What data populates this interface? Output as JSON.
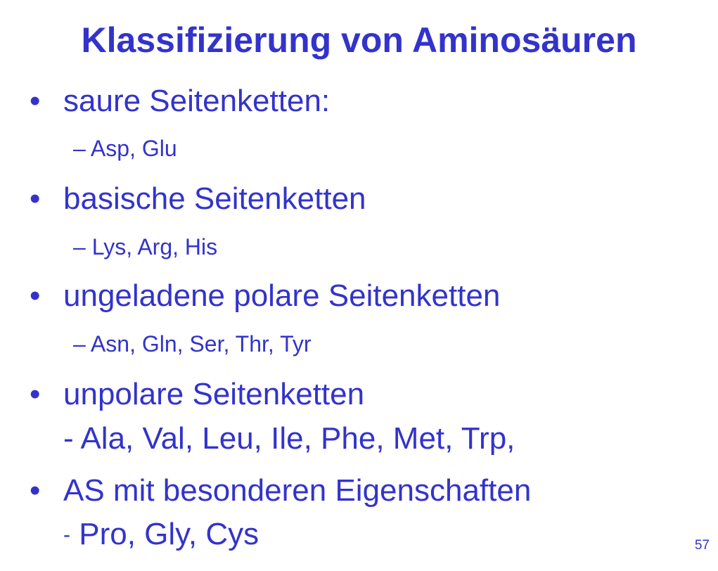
{
  "slide": {
    "title": "Klassifizierung von Aminosäuren",
    "bullet_glyph": "•",
    "items": [
      {
        "text": "saure Seitenketten:",
        "sub": "– Asp, Glu"
      },
      {
        "text": "basische Seitenketten",
        "sub": "– Lys, Arg, His"
      },
      {
        "text": "ungeladene polare Seitenketten",
        "sub": "– Asn, Gln, Ser, Thr, Tyr"
      },
      {
        "text": "unpolare Seitenketten",
        "cont": "- Ala, Val, Leu, Ile, Phe, Met, Trp,"
      },
      {
        "text": "AS mit besonderen Eigenschaften",
        "cont_dash": "-",
        "cont": "Pro, Gly, Cys"
      }
    ],
    "page_number": "57"
  },
  "colors": {
    "text": "#3333cc",
    "background": "#ffffff"
  }
}
